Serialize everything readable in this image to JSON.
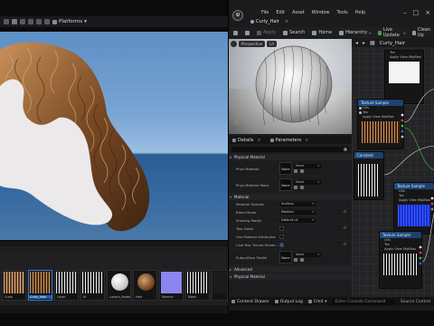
{
  "viewport_window": {
    "toolbar": {
      "platforms_label": "Platforms"
    }
  },
  "content_browser": {
    "thumbnails": [
      {
        "label": "Curls",
        "kind": "hair",
        "selected": false
      },
      {
        "label": "Curly_Hair",
        "kind": "hair",
        "selected": true
      },
      {
        "label": "Layer",
        "kind": "strands",
        "selected": false
      },
      {
        "label": "M",
        "kind": "strands",
        "selected": false
      },
      {
        "label": "Layers_Roots",
        "kind": "sphere",
        "selected": false
      },
      {
        "label": "Hair",
        "kind": "hairball",
        "selected": false
      },
      {
        "label": "Normal",
        "kind": "normal",
        "selected": false
      },
      {
        "label": "Mask",
        "kind": "strands",
        "selected": false
      },
      {
        "label": "",
        "kind": "dark",
        "selected": false
      }
    ]
  },
  "material_editor": {
    "menu": [
      "File",
      "Edit",
      "Asset",
      "Window",
      "Tools",
      "Help"
    ],
    "tab_title": "Curly_Hair",
    "toolbar": {
      "apply": "Apply",
      "search": "Search",
      "home": "Home",
      "hierarchy": "Hierarchy",
      "live_update": "Live Update",
      "clean_up": "Clean Up"
    },
    "preview": {
      "perspective": "Perspective",
      "lit": "Lit"
    },
    "graph": {
      "asset_label": "Curly_Hair",
      "nodes": [
        {
          "title": "",
          "rows": [
            "Tex",
            "Apply View MipBias"
          ],
          "outputs": [
            "RGB",
            "R",
            "G",
            "B",
            "A",
            "RGBA"
          ]
        },
        {
          "title": "Texture Sample",
          "rows": [
            "UVs",
            "Tex",
            "Apply View MipBias"
          ],
          "outputs": [
            "RGB",
            "R",
            "G",
            "B",
            "A",
            "RGBA"
          ]
        },
        {
          "title": "Constant",
          "rows": []
        },
        {
          "title": "Texture Sample",
          "rows": [
            "UVs",
            "Tex",
            "Apply View MipBias"
          ],
          "outputs": [
            "RGB",
            "R",
            "G",
            "B",
            "A",
            "RGBA"
          ]
        },
        {
          "title": "Texture Sample",
          "rows": [
            "UVs",
            "Tex",
            "Apply View MipBias"
          ],
          "outputs": [
            "RGB",
            "R",
            "G",
            "B",
            "A",
            "RGBA"
          ]
        }
      ]
    },
    "details": {
      "tabs": [
        {
          "label": "Details"
        },
        {
          "label": "Parameters"
        }
      ],
      "sections": {
        "physical_material": {
          "header": "Physical Material",
          "phys_material": {
            "label": "Phys Material",
            "thumb": "None",
            "value": "None"
          },
          "phys_material_mask": {
            "label": "Phys Material Mask",
            "thumb": "None",
            "value": "None"
          }
        },
        "material": {
          "header": "Material",
          "props": [
            {
              "label": "Material Domain",
              "value": "Surface",
              "type": "select"
            },
            {
              "label": "Blend Mode",
              "value": "Masked",
              "type": "select"
            },
            {
              "label": "Shading Model",
              "value": "Default Lit",
              "type": "select"
            },
            {
              "label": "Two Sided",
              "value": "",
              "type": "check",
              "checked": false
            },
            {
              "label": "Use Material Attributes",
              "value": "",
              "type": "check",
              "checked": false
            },
            {
              "label": "Cast Ray Traced Shado...",
              "value": "",
              "type": "check",
              "checked": true
            }
          ],
          "subsurface_profile": {
            "label": "Subsurface Profile",
            "thumb": "None",
            "value": "None"
          }
        },
        "advanced": {
          "header": "Advanced"
        },
        "physical_material_2": {
          "header": "Physical Material"
        }
      }
    },
    "status_bar": {
      "content_drawer": "Content Drawer",
      "output_log": "Output Log",
      "cmd": "Cmd",
      "console_placeholder": "Enter Console Command",
      "source_control": "Source Control"
    }
  },
  "colors": {
    "accent_blue": "#1a5fb4",
    "node_title_blue": "#1c4f8a",
    "pin_red": "#e04040",
    "pin_green": "#40c040",
    "pin_blue": "#4060e0",
    "sky_top": "#5e8fc4",
    "sea": "#2b5d92",
    "hair_brown": "#7a4a24"
  }
}
